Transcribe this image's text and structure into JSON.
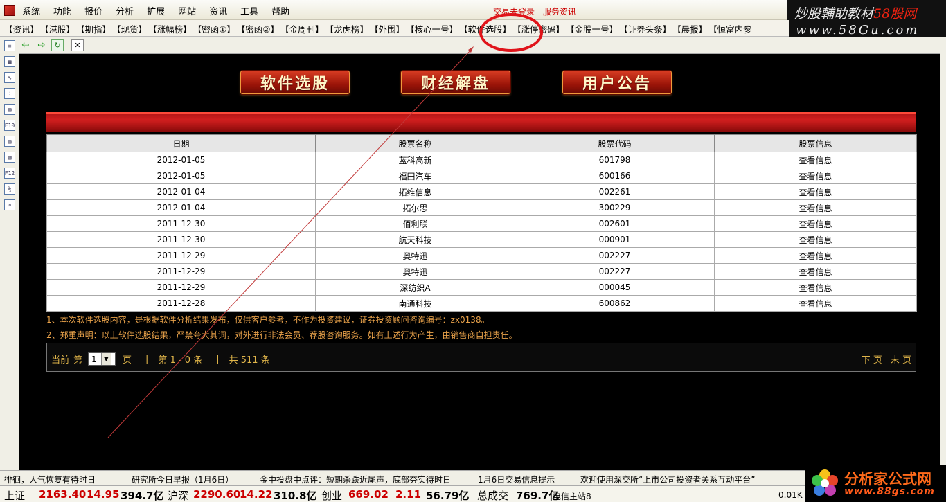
{
  "menu": {
    "items": [
      "系统",
      "功能",
      "报价",
      "分析",
      "扩展",
      "网站",
      "资讯",
      "工具",
      "帮助"
    ],
    "center_links": [
      "交易未登录",
      "服务资讯"
    ]
  },
  "watermark_top": {
    "line1_a": "炒股輔助教材",
    "line1_b": "58股网",
    "line2": "www.58Gu.com"
  },
  "tabs": [
    "【资讯】",
    "【港股】",
    "【期指】",
    "【现货】",
    "【涨幅榜】",
    "【密函①】",
    "【密函②】",
    "【金周刊】",
    "【龙虎榜】",
    "【外围】",
    "【核心一号】",
    "【软件选股】",
    "【涨停密码】",
    "【金股一号】",
    "【证券头条】",
    "【晨报】",
    "【恒富内参"
  ],
  "active_tab_index": 11,
  "toolbar": {
    "back": "⇦",
    "forward": "⇨",
    "refresh": "↻",
    "close": "✕"
  },
  "sidebar_icons": [
    "≡",
    "▦",
    "∿",
    "⫶",
    "▤",
    "F10",
    "▥",
    "▧",
    "F12",
    "½",
    "⌕"
  ],
  "buttons": {
    "software": "软件选股",
    "finance": "财经解盘",
    "notice": "用户公告"
  },
  "table": {
    "headers": [
      "日期",
      "股票名称",
      "股票代码",
      "股票信息"
    ],
    "rows": [
      [
        "2012-01-05",
        "蓝科高新",
        "601798",
        "查看信息"
      ],
      [
        "2012-01-05",
        "福田汽车",
        "600166",
        "查看信息"
      ],
      [
        "2012-01-04",
        "拓维信息",
        "002261",
        "查看信息"
      ],
      [
        "2012-01-04",
        "拓尔思",
        "300229",
        "查看信息"
      ],
      [
        "2011-12-30",
        "佰利联",
        "002601",
        "查看信息"
      ],
      [
        "2011-12-30",
        "航天科技",
        "000901",
        "查看信息"
      ],
      [
        "2011-12-29",
        "奥特迅",
        "002227",
        "查看信息"
      ],
      [
        "2011-12-29",
        "奥特迅",
        "002227",
        "查看信息"
      ],
      [
        "2011-12-29",
        "深纺织A",
        "000045",
        "查看信息"
      ],
      [
        "2011-12-28",
        "南通科技",
        "600862",
        "查看信息"
      ]
    ]
  },
  "notes": {
    "line1": "1、本次软件选股内容，是根据软件分析结果发布，仅供客户参考，不作为投资建议，证券投资顾问咨询编号：zx0138。",
    "line2": "2、郑重声明：以上软件选股结果，严禁夸大其词，对外进行非法会员、荐股咨询服务。如有上述行为产生，由销售商自担责任。"
  },
  "pager": {
    "current": "当前",
    "di": "第",
    "page_value": "1",
    "ye": "页",
    "sep": "|",
    "range": "第 1 - 0 条",
    "total": "共 511 条",
    "next": "下 页",
    "last": "末 页"
  },
  "ticker": [
    "徘徊，人气恢复有待时日",
    "研究所今日早报（1月6日）",
    "金中投盘中点评：短期杀跌近尾声，底部夯实待时日",
    "1月6日交易信息提示",
    "欢迎使用深交所“上市公司投资者关系互动平台”"
  ],
  "indexbar": {
    "sh_label": "上证",
    "sh_value": "2163.40",
    "sh_change": "14.95",
    "sh_amount": "394.7亿",
    "hs_label": "沪深",
    "hs_value": "2290.60",
    "hs_change": "14.22",
    "hs_amount": "310.8亿",
    "cy_label": "创业",
    "cy_value": "669.02",
    "cy_change": "2.11",
    "cy_amount": "56.79亿",
    "total_label": "总成交",
    "total_value": "769.7亿",
    "server": "电信主站8",
    "speed": "0.01K"
  },
  "watermark_bottom": {
    "line1": "分析家公式网",
    "line2": "www.88gs.com"
  },
  "colors": {
    "accent_red": "#c00",
    "button_red": "#9b1408",
    "note_orange": "#e9a24a",
    "pager_gold": "#e0b54a"
  }
}
